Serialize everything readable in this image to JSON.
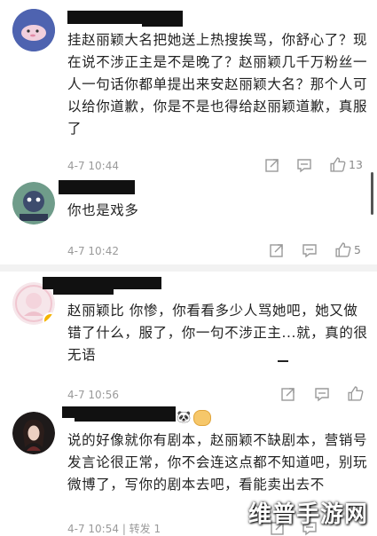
{
  "colors": {
    "background": "#ffffff",
    "divider": "#f2f2f2",
    "meta_text": "#9a9a9a",
    "redaction": "#111111"
  },
  "comments": [
    {
      "username": "",
      "text": "挂赵丽颖大名把她送上热搜挨骂，你舒心了？现在说不涉正主是不是晚了？赵丽颖几千万粉丝一人一句话你都单提出来安赵丽颖大名？那个人可以给你道歉，你是不是也得给赵丽颖道歉，真服了",
      "time": "4-7 10:44",
      "likes": "13"
    },
    {
      "username": "",
      "text": "你也是戏多",
      "time": "4-7 10:42",
      "likes": "5"
    },
    {
      "username": "",
      "text": "赵丽颖比 你惨，你看看多少人骂她吧，她又做错了什么，服了，你一句不涉正主...就，真的很无语",
      "time": "4-7 10:56",
      "likes": ""
    },
    {
      "username": "",
      "text": "说的好像就你有剧本，赵丽颖不缺剧本，营销号发言论很正常，你不会连这点都不知道吧，别玩微博了，写你的剧本去吧，看能卖出去不",
      "time": "4-7 10:54",
      "repost": "| 转发 1",
      "likes": ""
    }
  ],
  "icons": [
    "share-icon",
    "comment-icon",
    "like-icon"
  ],
  "watermark": "维普手游网"
}
